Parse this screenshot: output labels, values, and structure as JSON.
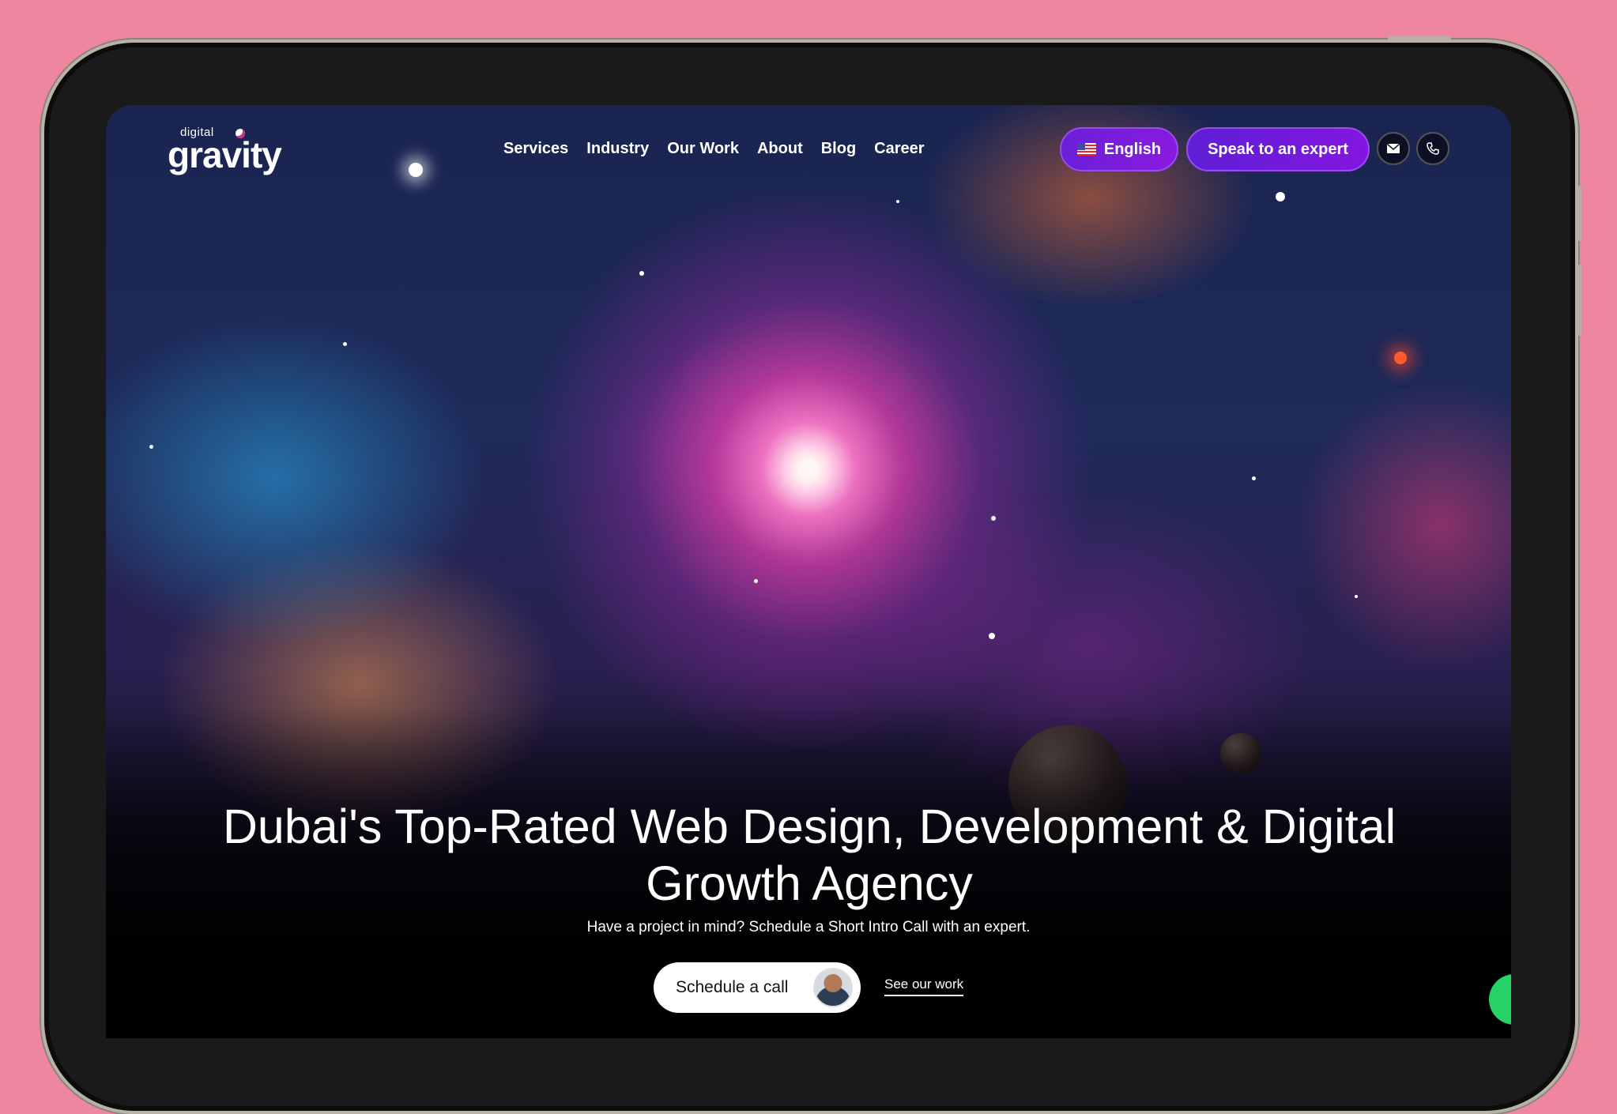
{
  "logo": {
    "small": "digital",
    "main": "gravity"
  },
  "nav": {
    "items": [
      "Services",
      "Industry",
      "Our Work",
      "About",
      "Blog",
      "Career"
    ]
  },
  "header": {
    "language_label": "English",
    "cta_label": "Speak to an expert"
  },
  "hero": {
    "title": "Dubai's Top-Rated Web Design, Development & Digital Growth Agency",
    "subtitle": "Have a project in mind? Schedule a Short Intro Call with an expert.",
    "schedule_label": "Schedule a call",
    "see_work_label": "See our work"
  },
  "colors": {
    "background": "#ee869f",
    "accent": "#7a1ae0",
    "whatsapp": "#25d366"
  }
}
